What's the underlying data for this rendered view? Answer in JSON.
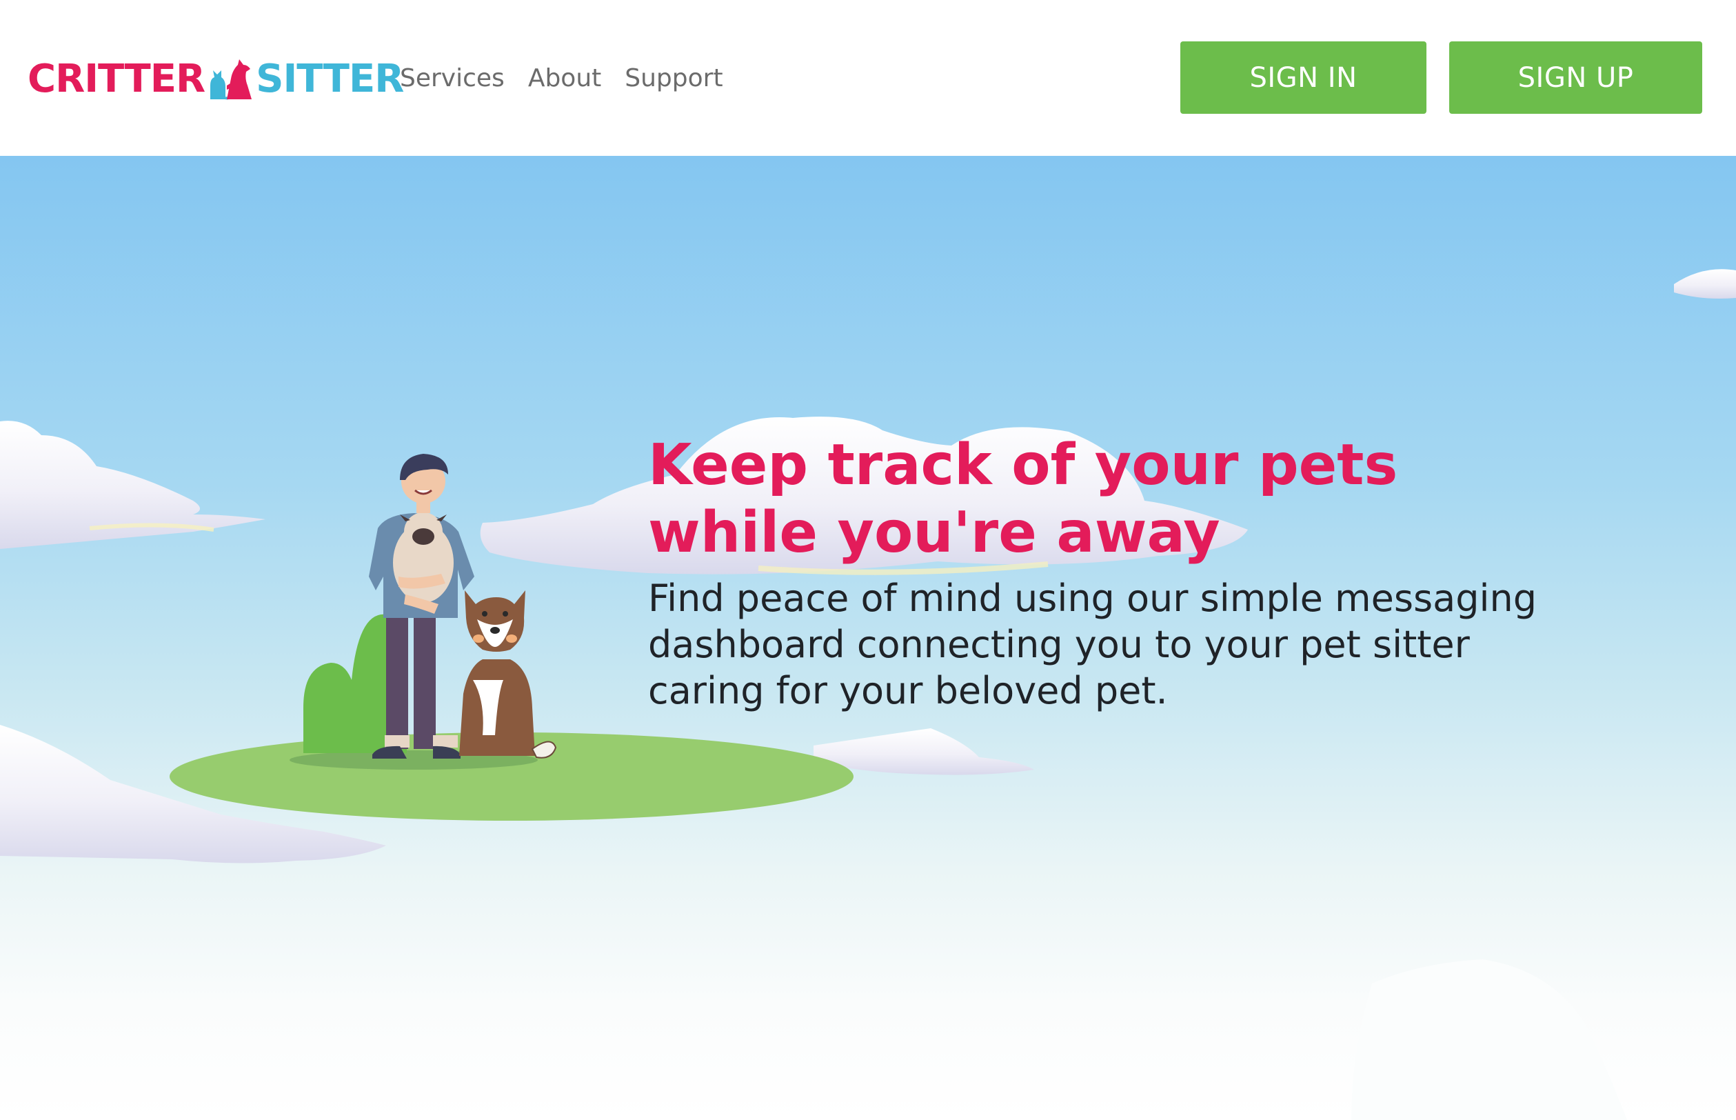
{
  "brand": {
    "name_part_1": "CRITTER",
    "name_part_2": "SITTER",
    "color_primary": "#e31c5a",
    "color_secondary": "#3fb6d8",
    "icon": "dog-and-cat-logo-icon"
  },
  "nav": {
    "items": [
      {
        "label": "Services"
      },
      {
        "label": "About"
      },
      {
        "label": "Support"
      }
    ]
  },
  "auth": {
    "sign_in_label": "SIGN IN",
    "sign_up_label": "SIGN UP",
    "button_color": "#6cbd4b"
  },
  "hero": {
    "headline": "Keep track of your pets while you're away",
    "subtext": "Find peace of mind using our simple messaging dashboard connecting you to your pet sitter caring for your beloved pet.",
    "headline_color": "#e31c5a",
    "illustration": "person-with-pug-and-dog-illustration"
  }
}
